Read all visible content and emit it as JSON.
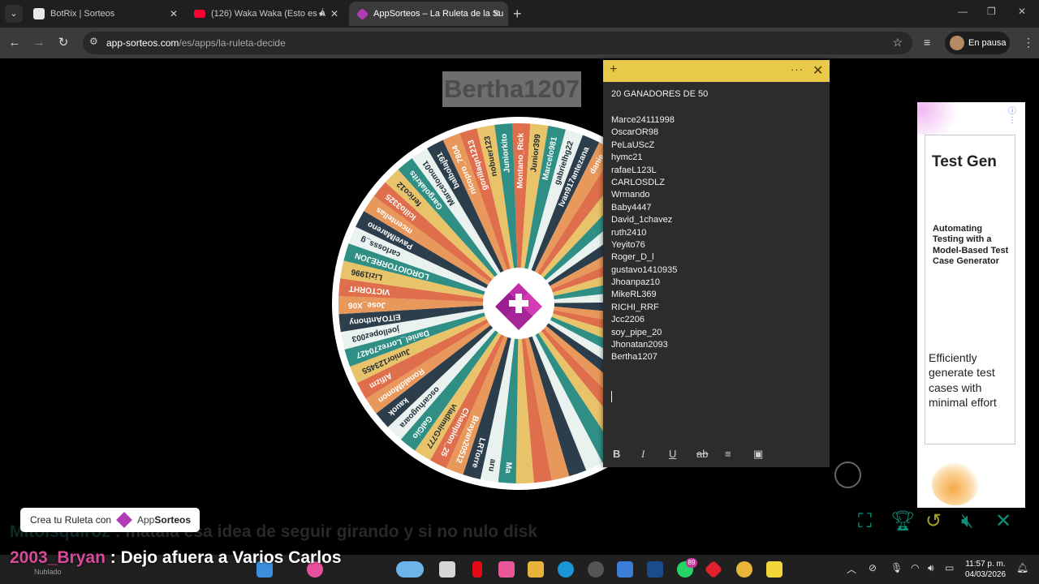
{
  "browser": {
    "tabs": [
      {
        "title": "BotRix | Sorteos",
        "favicon_color": "#e8e8e8",
        "active": false
      },
      {
        "title": "(126) Waka Waka (Esto es Á",
        "favicon_color": "#ff0033",
        "active": false
      },
      {
        "title": "AppSorteos – La Ruleta de la Su",
        "favicon_color": "#b03bb4",
        "active": true
      }
    ],
    "url_host": "app-sorteos.com",
    "url_path": "/es/apps/la-ruleta-decide",
    "profile_label": "En pausa"
  },
  "winner_display": "Bertha1207",
  "wheel": {
    "colors": [
      "#df6f4c",
      "#e8c36a",
      "#2f8f84",
      "#e9f2ef",
      "#2c3e4c",
      "#e7985a"
    ],
    "names": [
      "Montano_Rick",
      "Junior399",
      "Marcelo981",
      "gabrielhg22",
      "Ivan917antezana",
      "danie",
      "",
      "",
      "",
      "",
      "",
      "",
      "",
      "",
      "",
      "",
      "",
      "",
      "",
      "",
      "",
      "",
      "",
      "",
      "",
      "",
      "",
      "",
      "",
      "",
      "",
      "",
      "Ma",
      "aru",
      "LRTorre",
      "Brayan20512",
      "Champion_25",
      "vladimirG777",
      "GalGio",
      "oscarhugoara",
      "kauok",
      "RonaldMonon",
      "Alfizm",
      "Junior123455",
      "Daniel_Lorrez70427",
      "joellopez003",
      "ElTOAnthony",
      "Jose_X06",
      "VICTORHT",
      "Lizi1996",
      "LOROIOTORREJON",
      "carlosss_g",
      "PavelMareno",
      "mcentellas",
      "lcillo3325",
      "ferico12",
      "Gargolakrits",
      "Marcelomo01",
      "balbolaj91",
      "nicopro_7804",
      "gorillaqn1213",
      "nobuer123",
      "Juniorkito"
    ]
  },
  "notes": {
    "title": "20 GANADORES DE 50",
    "winners": [
      "Marce24111998",
      "OscarOR98",
      "PeLaUScZ",
      "hymc21",
      "rafaeL123L",
      "CARLOSDLZ",
      "Wrmando",
      "Baby4447",
      "David_1chavez",
      "ruth2410",
      "Yeyito76",
      "Roger_D_l",
      "gustavo1410935",
      "Jhoanpaz10",
      "MikeRL369",
      "RICHI_RRF",
      "Jcc2206",
      "soy_pipe_20",
      "Jhonatan2093",
      "Bertha1207"
    ],
    "format_buttons": [
      "B",
      "I",
      "U",
      "ab",
      "≡",
      "▣"
    ]
  },
  "ad": {
    "heading": "Test Gen",
    "subheading": "Automating Testing with a Model-Based Test Case Generator",
    "description": "Efficiently generate test cases with minimal effort"
  },
  "create_badge": {
    "prefix": "Crea tu Ruleta con",
    "brand_a": "App",
    "brand_b": "Sorteos"
  },
  "chat": {
    "faint_user": "Mitoisquiroz",
    "faint_text": " : matala esa idea de seguir girando y si no nulo disk",
    "main_user": "2003_Bryan",
    "main_text": " : Dejo afuera a Varios Carlos"
  },
  "taskbar": {
    "weather": "Nublado",
    "time": "11:57 p. m.",
    "date": "04/03/2026",
    "store_badge": "89"
  }
}
